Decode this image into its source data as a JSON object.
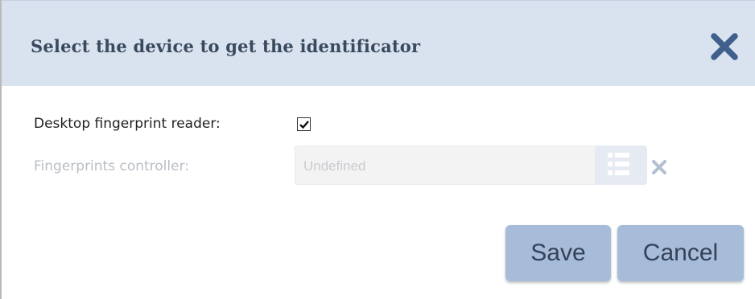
{
  "dialog": {
    "title": "Select the device to get the identificator",
    "close_icon": "close-icon"
  },
  "form": {
    "desktop_reader_label": "Desktop fingerprint reader:",
    "desktop_reader_checked": true,
    "controller_label": "Fingerprints controller:",
    "controller_value": "Undefined",
    "controller_disabled": true,
    "list_icon": "list-icon",
    "clear_icon": "clear-icon"
  },
  "buttons": {
    "save_label": "Save",
    "cancel_label": "Cancel"
  },
  "colors": {
    "header_bg": "#d9e3f0",
    "title_color": "#3a4a5e",
    "close_icon": "#3f5f8c",
    "button_bg": "#a7bcd9",
    "disabled_text": "#b8bec6"
  }
}
